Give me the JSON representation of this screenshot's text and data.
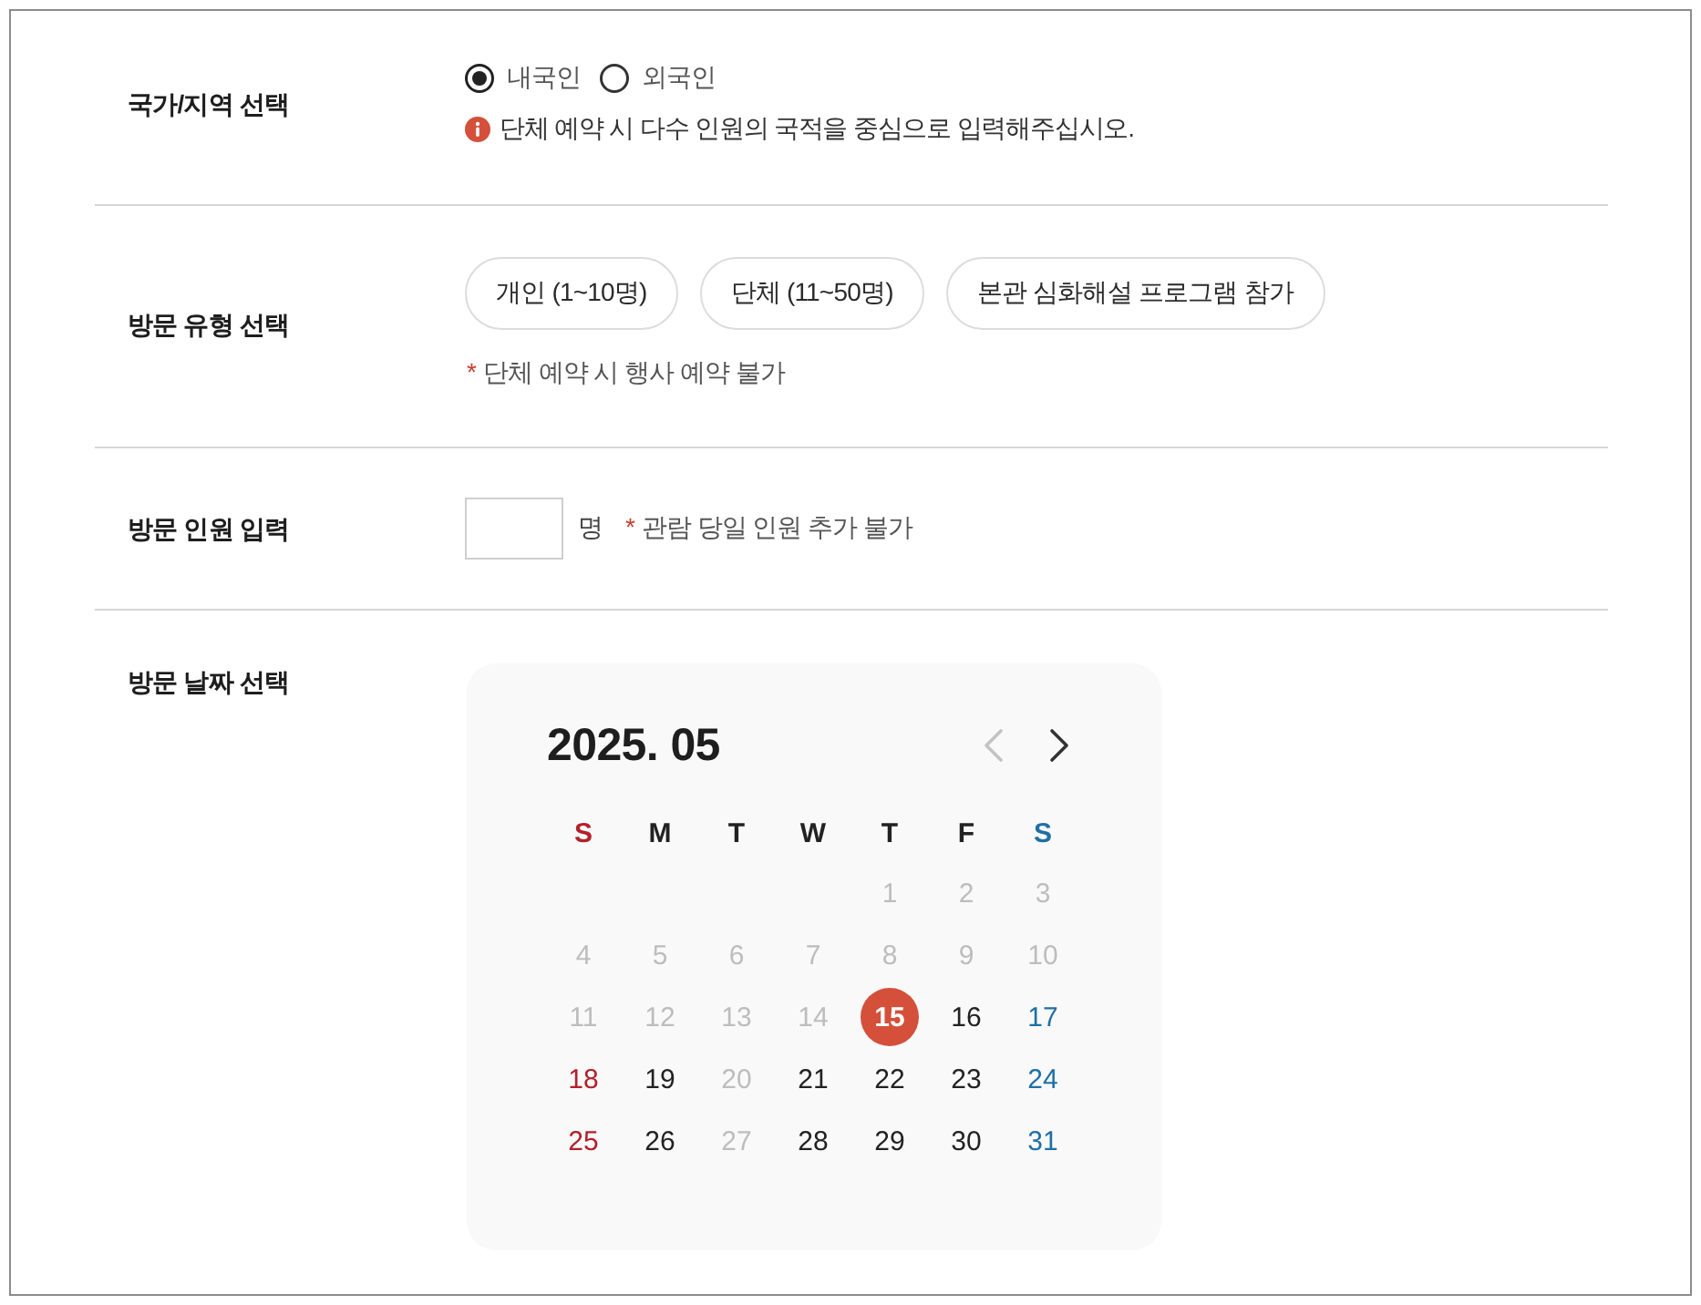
{
  "sections": [
    {
      "kind": "radio",
      "label": "국가/지역 선택",
      "options": [
        {
          "label": "내국인",
          "selected": true
        },
        {
          "label": "외국인",
          "selected": false
        }
      ],
      "info": "단체 예약 시 다수 인원의 국적을 중심으로 입력해주십시오."
    },
    {
      "kind": "choices",
      "label": "방문 유형 선택",
      "options": [
        {
          "label": "개인 (1~10명)",
          "selected": false
        },
        {
          "label": "단체 (11~50명)",
          "selected": false
        },
        {
          "label": "본관 심화해설 프로그램 참가",
          "selected": false
        }
      ],
      "note": {
        "marker": "*",
        "text": "단체 예약 시 행사 예약 불가"
      }
    },
    {
      "kind": "count",
      "label": "방문 인원 입력",
      "unit": "명",
      "note": {
        "marker": "*",
        "text": "관람 당일 인원 추가 불가"
      }
    },
    {
      "kind": "calendar",
      "label": "방문 날짜 선택",
      "calendar": {
        "title": "2025. 05",
        "prev_disabled": true,
        "next_disabled": false,
        "weekdays": [
          "S",
          "M",
          "T",
          "W",
          "T",
          "F",
          "S"
        ],
        "weeks": [
          [
            {
              "day": "1",
              "disabled": true,
              "selected": false
            },
            {
              "day": "2",
              "disabled": true,
              "selected": false
            },
            {
              "day": "3",
              "disabled": true,
              "selected": false
            }
          ],
          [
            {
              "day": "4",
              "disabled": true,
              "selected": false
            },
            {
              "day": "5",
              "disabled": true,
              "selected": false
            },
            {
              "day": "6",
              "disabled": true,
              "selected": false
            },
            {
              "day": "7",
              "disabled": true,
              "selected": false
            },
            {
              "day": "8",
              "disabled": true,
              "selected": false
            },
            {
              "day": "9",
              "disabled": true,
              "selected": false
            },
            {
              "day": "10",
              "disabled": true,
              "selected": false
            }
          ],
          [
            {
              "day": "11",
              "disabled": true,
              "selected": false
            },
            {
              "day": "12",
              "disabled": true,
              "selected": false
            },
            {
              "day": "13",
              "disabled": true,
              "selected": false
            },
            {
              "day": "14",
              "disabled": true,
              "selected": false
            },
            {
              "day": "15",
              "disabled": false,
              "selected": true
            },
            {
              "day": "16",
              "disabled": false,
              "selected": false
            },
            {
              "day": "17",
              "disabled": false,
              "selected": false
            }
          ],
          [
            {
              "day": "18",
              "disabled": false,
              "selected": false
            },
            {
              "day": "19",
              "disabled": false,
              "selected": false
            },
            {
              "day": "20",
              "disabled": true,
              "selected": false
            },
            {
              "day": "21",
              "disabled": false,
              "selected": false
            },
            {
              "day": "22",
              "disabled": false,
              "selected": false
            },
            {
              "day": "23",
              "disabled": false,
              "selected": false
            },
            {
              "day": "24",
              "disabled": false,
              "selected": false
            }
          ],
          [
            {
              "day": "25",
              "disabled": false,
              "selected": false
            },
            {
              "day": "26",
              "disabled": false,
              "selected": false
            },
            {
              "day": "27",
              "disabled": true,
              "selected": false
            },
            {
              "day": "28",
              "disabled": false,
              "selected": false
            },
            {
              "day": "29",
              "disabled": false,
              "selected": false
            },
            {
              "day": "30",
              "disabled": false,
              "selected": false
            },
            {
              "day": "31",
              "disabled": false,
              "selected": false
            }
          ]
        ]
      }
    }
  ]
}
